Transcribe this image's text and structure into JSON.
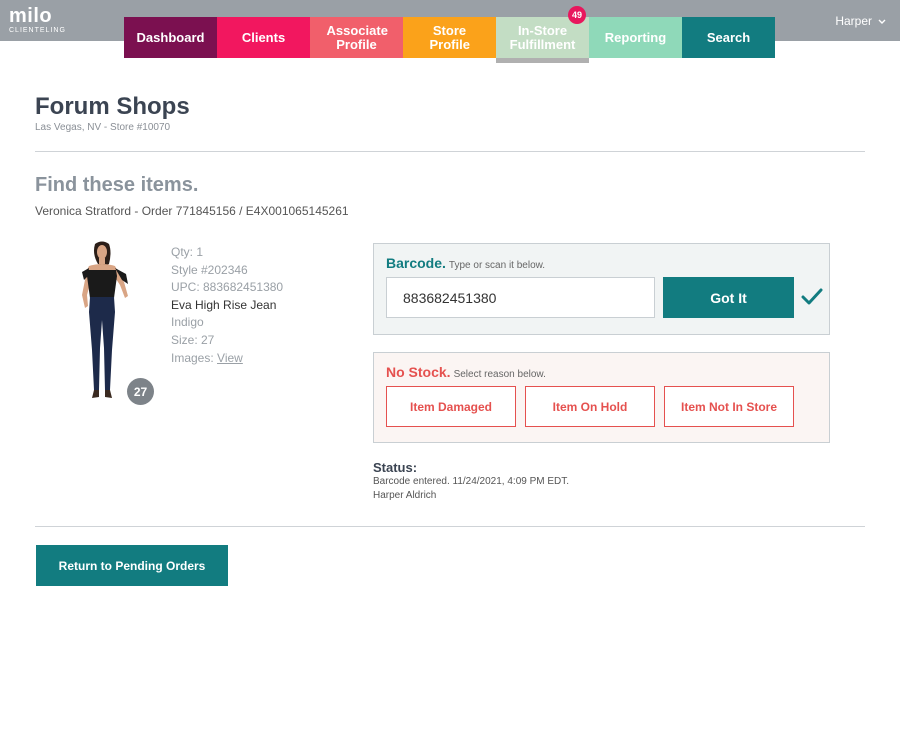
{
  "brand": {
    "name": "milo",
    "tagline": "CLIENTELING"
  },
  "user": {
    "name": "Harper"
  },
  "nav": {
    "tabs": [
      {
        "label": "Dashboard",
        "color": "#7b1050"
      },
      {
        "label": "Clients",
        "color": "#f2175f"
      },
      {
        "label": "Associate Profile",
        "color": "#f15f6b"
      },
      {
        "label": "Store Profile",
        "color": "#fba21a"
      },
      {
        "label": "In-Store Fulfillment",
        "color": "#c3ddc4",
        "badge": "49",
        "active": true
      },
      {
        "label": "Reporting",
        "color": "#8fd9b9"
      },
      {
        "label": "Search",
        "color": "#127c80"
      }
    ]
  },
  "store": {
    "name": "Forum Shops",
    "location": "Las Vegas, NV - Store #10070"
  },
  "order": {
    "heading": "Find these items.",
    "summary": "Veronica Stratford - Order 771845156 / E4X001065145261"
  },
  "item": {
    "qty": "Qty: 1",
    "style": "Style #202346",
    "upc": "UPC: 883682451380",
    "name": "Eva High Rise Jean",
    "color": "Indigo",
    "size": "Size: 27",
    "images_label": "Images:",
    "images_link": "View",
    "size_badge": "27"
  },
  "barcode": {
    "title": "Barcode.",
    "hint": "Type or scan it below.",
    "value": "883682451380",
    "button": "Got It",
    "title_color": "#127c80"
  },
  "no_stock": {
    "title": "No Stock.",
    "hint": "Select reason below.",
    "reasons": [
      "Item Damaged",
      "Item On Hold",
      "Item Not In Store"
    ],
    "title_color": "#e5514f"
  },
  "status": {
    "title": "Status:",
    "line1": "Barcode entered. 11/24/2021, 4:09 PM EDT.",
    "line2": "Harper Aldrich"
  },
  "return_button": "Return to Pending Orders"
}
